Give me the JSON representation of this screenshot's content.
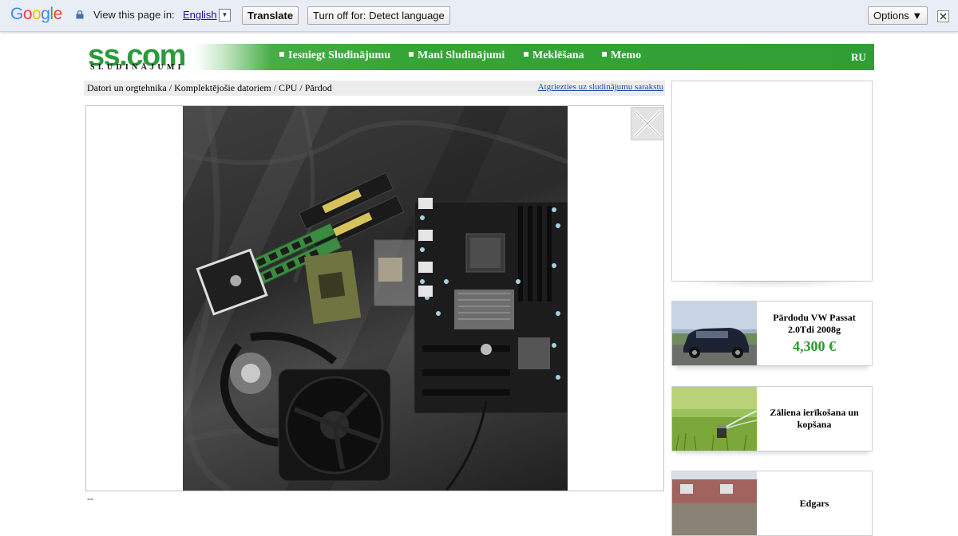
{
  "translate_bar": {
    "logo_letters": [
      "G",
      "o",
      "o",
      "g",
      "l",
      "e"
    ],
    "logo_colors": [
      "#4285f4",
      "#ea4335",
      "#fbbc05",
      "#4285f4",
      "#34a853",
      "#ea4335"
    ],
    "view_text": "View this page in:",
    "language": "English",
    "language_dropdown_glyph": "▼",
    "translate_label": "Translate",
    "turn_off_label": "Turn off for: Detect language",
    "options_label": "Options ▼"
  },
  "header": {
    "logo": "ss.com",
    "logo_sub": "SLUDINĀJUMI",
    "nav": [
      {
        "label": "Iesniegt Sludinājumu"
      },
      {
        "label": "Mani Sludinājumi"
      },
      {
        "label": "Meklēšana"
      },
      {
        "label": "Memo"
      }
    ],
    "lang_switch": "RU",
    "accent": "#2f9e35"
  },
  "breadcrumb": {
    "path": "Datori un orgtehnika / Komplektējošie datoriem / CPU / Pārdod",
    "back_link": "Atgriezties uz sludinājumu sarakstu"
  },
  "viewer": {
    "photo_subject": "motherboard-cpu-ram-cooler-photo",
    "pager_text": "--"
  },
  "sidebar": {
    "cards": [
      {
        "title": "Pārdodu VW Passat 2.0Tdi 2008g",
        "price": "4,300 €",
        "thumb": "car-photo"
      },
      {
        "title": "Zāliena ierīkošana un kopšana",
        "price": "",
        "thumb": "lawn-sprinkler-photo"
      },
      {
        "title": "Edgars",
        "price": "",
        "thumb": "house-photo"
      }
    ]
  }
}
